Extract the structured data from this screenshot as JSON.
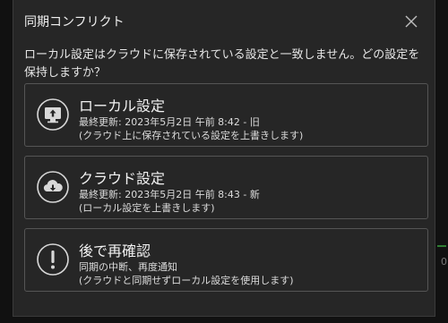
{
  "dialog": {
    "title": "同期コンフリクト",
    "message": "ローカル設定はクラウドに保存されている設定と一致しません。どの設定を保持しますか？"
  },
  "options": [
    {
      "icon": "monitor-upload-icon",
      "title": "ローカル設定",
      "line1": "最終更新: 2023年5月2日 午前 8:42 - 旧",
      "line2": "(クラウド上に保存されている設定を上書きします)"
    },
    {
      "icon": "cloud-download-icon",
      "title": "クラウド設定",
      "line1": "最終更新: 2023年5月2日 午前 8:43 - 新",
      "line2": "(ローカル設定を上書きします)"
    },
    {
      "icon": "exclamation-icon",
      "title": "後で再確認",
      "line1": "同期の中断、再度通知",
      "line2": "(クラウドと同期せずローカル設定を使用します)"
    }
  ],
  "background": {
    "right_text": "0"
  }
}
